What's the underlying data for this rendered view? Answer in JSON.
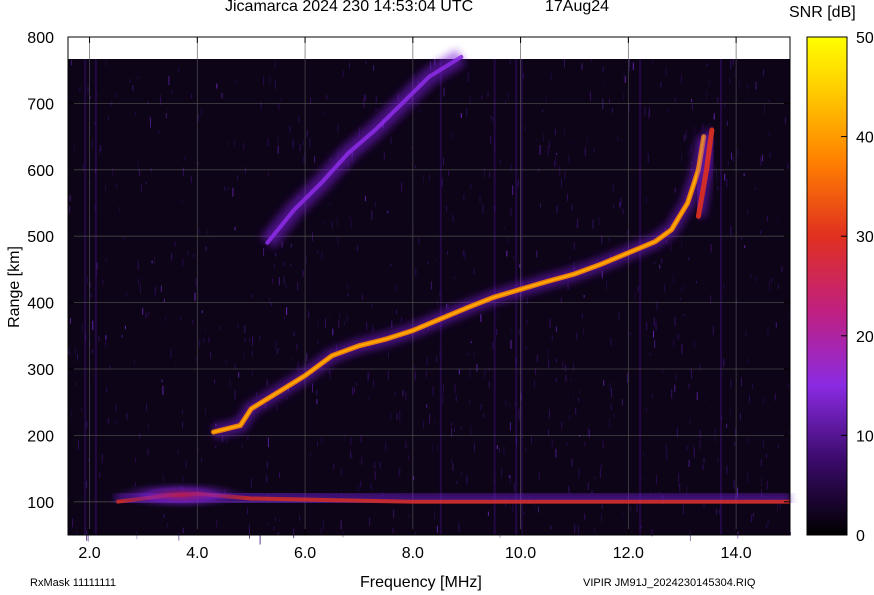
{
  "header": {
    "title": "Jicamarca 2024 230 14:53:04 UTC",
    "date": "17Aug24"
  },
  "footer": {
    "rxmask": "RxMask 11111111",
    "file": "VIPIR  JM91J_2024230145304.RIQ"
  },
  "colorbar": {
    "label": "SNR [dB]",
    "min": 0,
    "max": 50,
    "ticks": [
      0,
      10,
      20,
      30,
      40,
      50
    ]
  },
  "chart_data": {
    "type": "heatmap",
    "title": "Jicamarca 2024 230 14:53:04 UTC",
    "xlabel": "Frequency [MHz]",
    "ylabel": "Range [km]",
    "xlim": [
      1.6,
      15.0
    ],
    "ylim": [
      50,
      800
    ],
    "xticks": [
      "2.0",
      "4.0",
      "6.0",
      "8.0",
      "10.0",
      "12.0",
      "14.0"
    ],
    "yticks": [
      "100",
      "200",
      "300",
      "400",
      "500",
      "600",
      "700",
      "800"
    ],
    "grid": true,
    "traces": [
      {
        "name": "F-region trace",
        "peak_snr_db": 40,
        "points": [
          [
            4.3,
            205
          ],
          [
            4.8,
            215
          ],
          [
            5.0,
            240
          ],
          [
            5.5,
            265
          ],
          [
            6.0,
            290
          ],
          [
            6.5,
            320
          ],
          [
            7.0,
            335
          ],
          [
            7.5,
            345
          ],
          [
            8.0,
            358
          ],
          [
            8.5,
            375
          ],
          [
            9.0,
            392
          ],
          [
            9.5,
            408
          ],
          [
            10.0,
            420
          ],
          [
            10.5,
            432
          ],
          [
            11.0,
            443
          ],
          [
            11.5,
            458
          ],
          [
            12.0,
            475
          ],
          [
            12.5,
            492
          ],
          [
            12.8,
            510
          ],
          [
            13.1,
            550
          ],
          [
            13.3,
            600
          ],
          [
            13.4,
            650
          ]
        ]
      },
      {
        "name": "F-region second hop",
        "peak_snr_db": 20,
        "points": [
          [
            5.3,
            490
          ],
          [
            5.8,
            540
          ],
          [
            6.3,
            580
          ],
          [
            6.8,
            625
          ],
          [
            7.3,
            660
          ],
          [
            7.8,
            700
          ],
          [
            8.3,
            740
          ],
          [
            8.9,
            770
          ]
        ]
      },
      {
        "name": "O-X split trace",
        "peak_snr_db": 30,
        "points": [
          [
            13.3,
            530
          ],
          [
            13.45,
            600
          ],
          [
            13.55,
            660
          ]
        ]
      },
      {
        "name": "E-region echoes",
        "peak_snr_db": 25,
        "points": [
          [
            2.5,
            100
          ],
          [
            3.5,
            110
          ],
          [
            4.0,
            112
          ],
          [
            5.0,
            105
          ],
          [
            8.0,
            100
          ],
          [
            12.0,
            100
          ],
          [
            15.0,
            100
          ]
        ]
      }
    ]
  }
}
